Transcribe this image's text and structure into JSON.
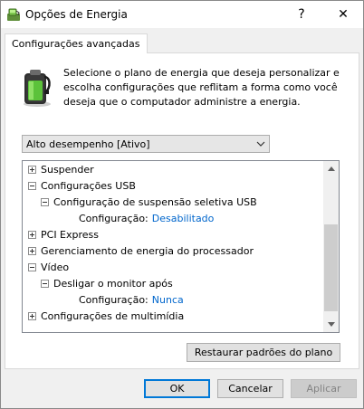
{
  "window": {
    "title": "Opções de Energia",
    "help_label": "?",
    "close_label": "✕"
  },
  "tab": {
    "label": "Configurações avançadas"
  },
  "description": "Selecione o plano de energia que deseja personalizar e escolha configurações que reflitam a forma como você deseja que o computador administre a energia.",
  "plan_select": {
    "selected": "Alto desempenho [Ativo]"
  },
  "tree": {
    "suspend": "Suspender",
    "usb": "Configurações USB",
    "usb_selective": "Configuração de suspensão seletiva USB",
    "usb_setting_label": "Configuração:",
    "usb_setting_value": "Desabilitado",
    "pci": "PCI Express",
    "processor": "Gerenciamento de energia do processador",
    "video": "Vídeo",
    "monitor_off": "Desligar o monitor após",
    "monitor_setting_label": "Configuração:",
    "monitor_setting_value": "Nunca",
    "multimedia": "Configurações de multimídia"
  },
  "buttons": {
    "restore": "Restaurar padrões do plano",
    "ok": "OK",
    "cancel": "Cancelar",
    "apply": "Aplicar"
  },
  "colors": {
    "accent": "#0078d7",
    "setting_value": "#0066cc",
    "panel_bg": "#ffffff",
    "window_bg": "#f0f0f0"
  }
}
